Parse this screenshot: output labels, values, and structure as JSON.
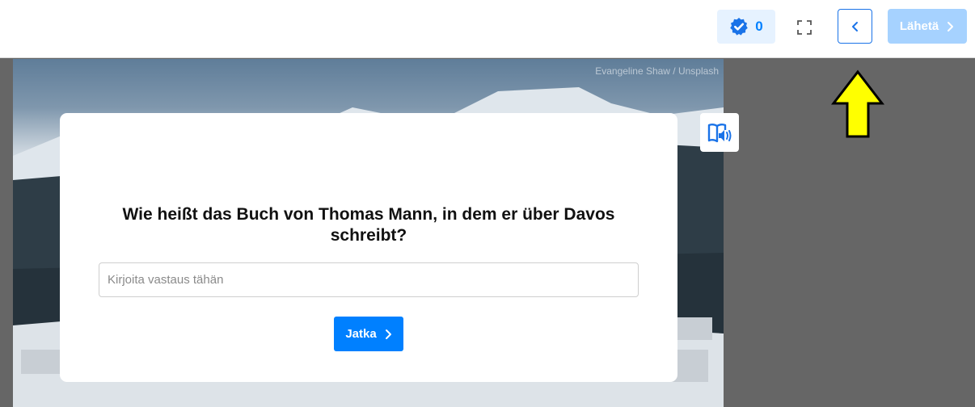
{
  "header": {
    "score": "0",
    "submit_label": "Lähetä"
  },
  "image": {
    "credit": "Evangeline Shaw / Unsplash"
  },
  "quiz": {
    "question": "Wie heißt das Buch von Thomas Mann, in dem er über Davos schreibt?",
    "answer_value": "",
    "answer_placeholder": "Kirjoita vastaus tähän",
    "continue_label": "Jatka"
  },
  "colors": {
    "accent": "#0080ff",
    "disabled_accent": "#a6d2ff",
    "badge_bg": "#e6f2ff",
    "overlay": "#666666",
    "annotation_arrow": "#ffff00"
  },
  "icons": [
    "verified-check-icon",
    "fullscreen-icon",
    "chevron-left-icon",
    "chevron-right-icon",
    "read-aloud-icon",
    "annotation-arrow-icon"
  ]
}
